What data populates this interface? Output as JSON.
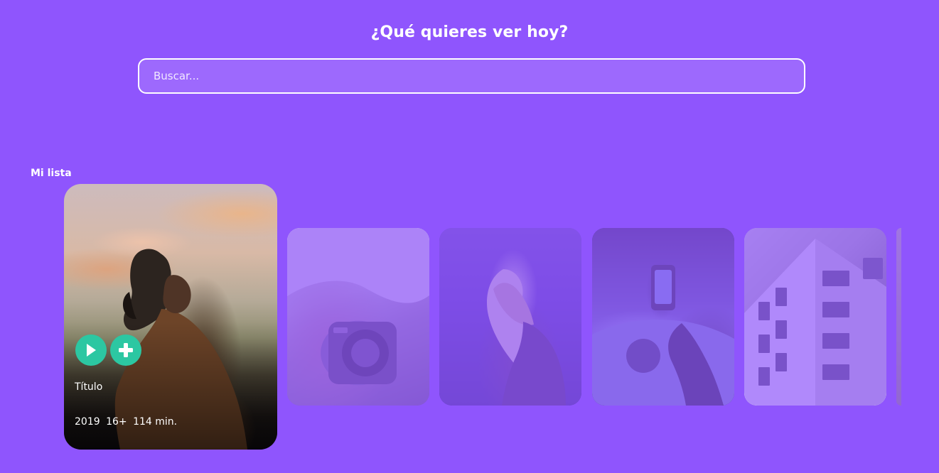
{
  "header": {
    "title": "¿Qué quieres ver hoy?",
    "search_placeholder": "Buscar..."
  },
  "section": {
    "title": "Mi lista"
  },
  "featured": {
    "title": "Título",
    "year": "2019",
    "rating": "16+",
    "duration": "114 min."
  },
  "icons": {
    "play": "play-icon",
    "add": "plus-icon"
  },
  "colors": {
    "background": "#8f55fd",
    "accent": "#2cc7a2",
    "text": "#ffffff"
  }
}
